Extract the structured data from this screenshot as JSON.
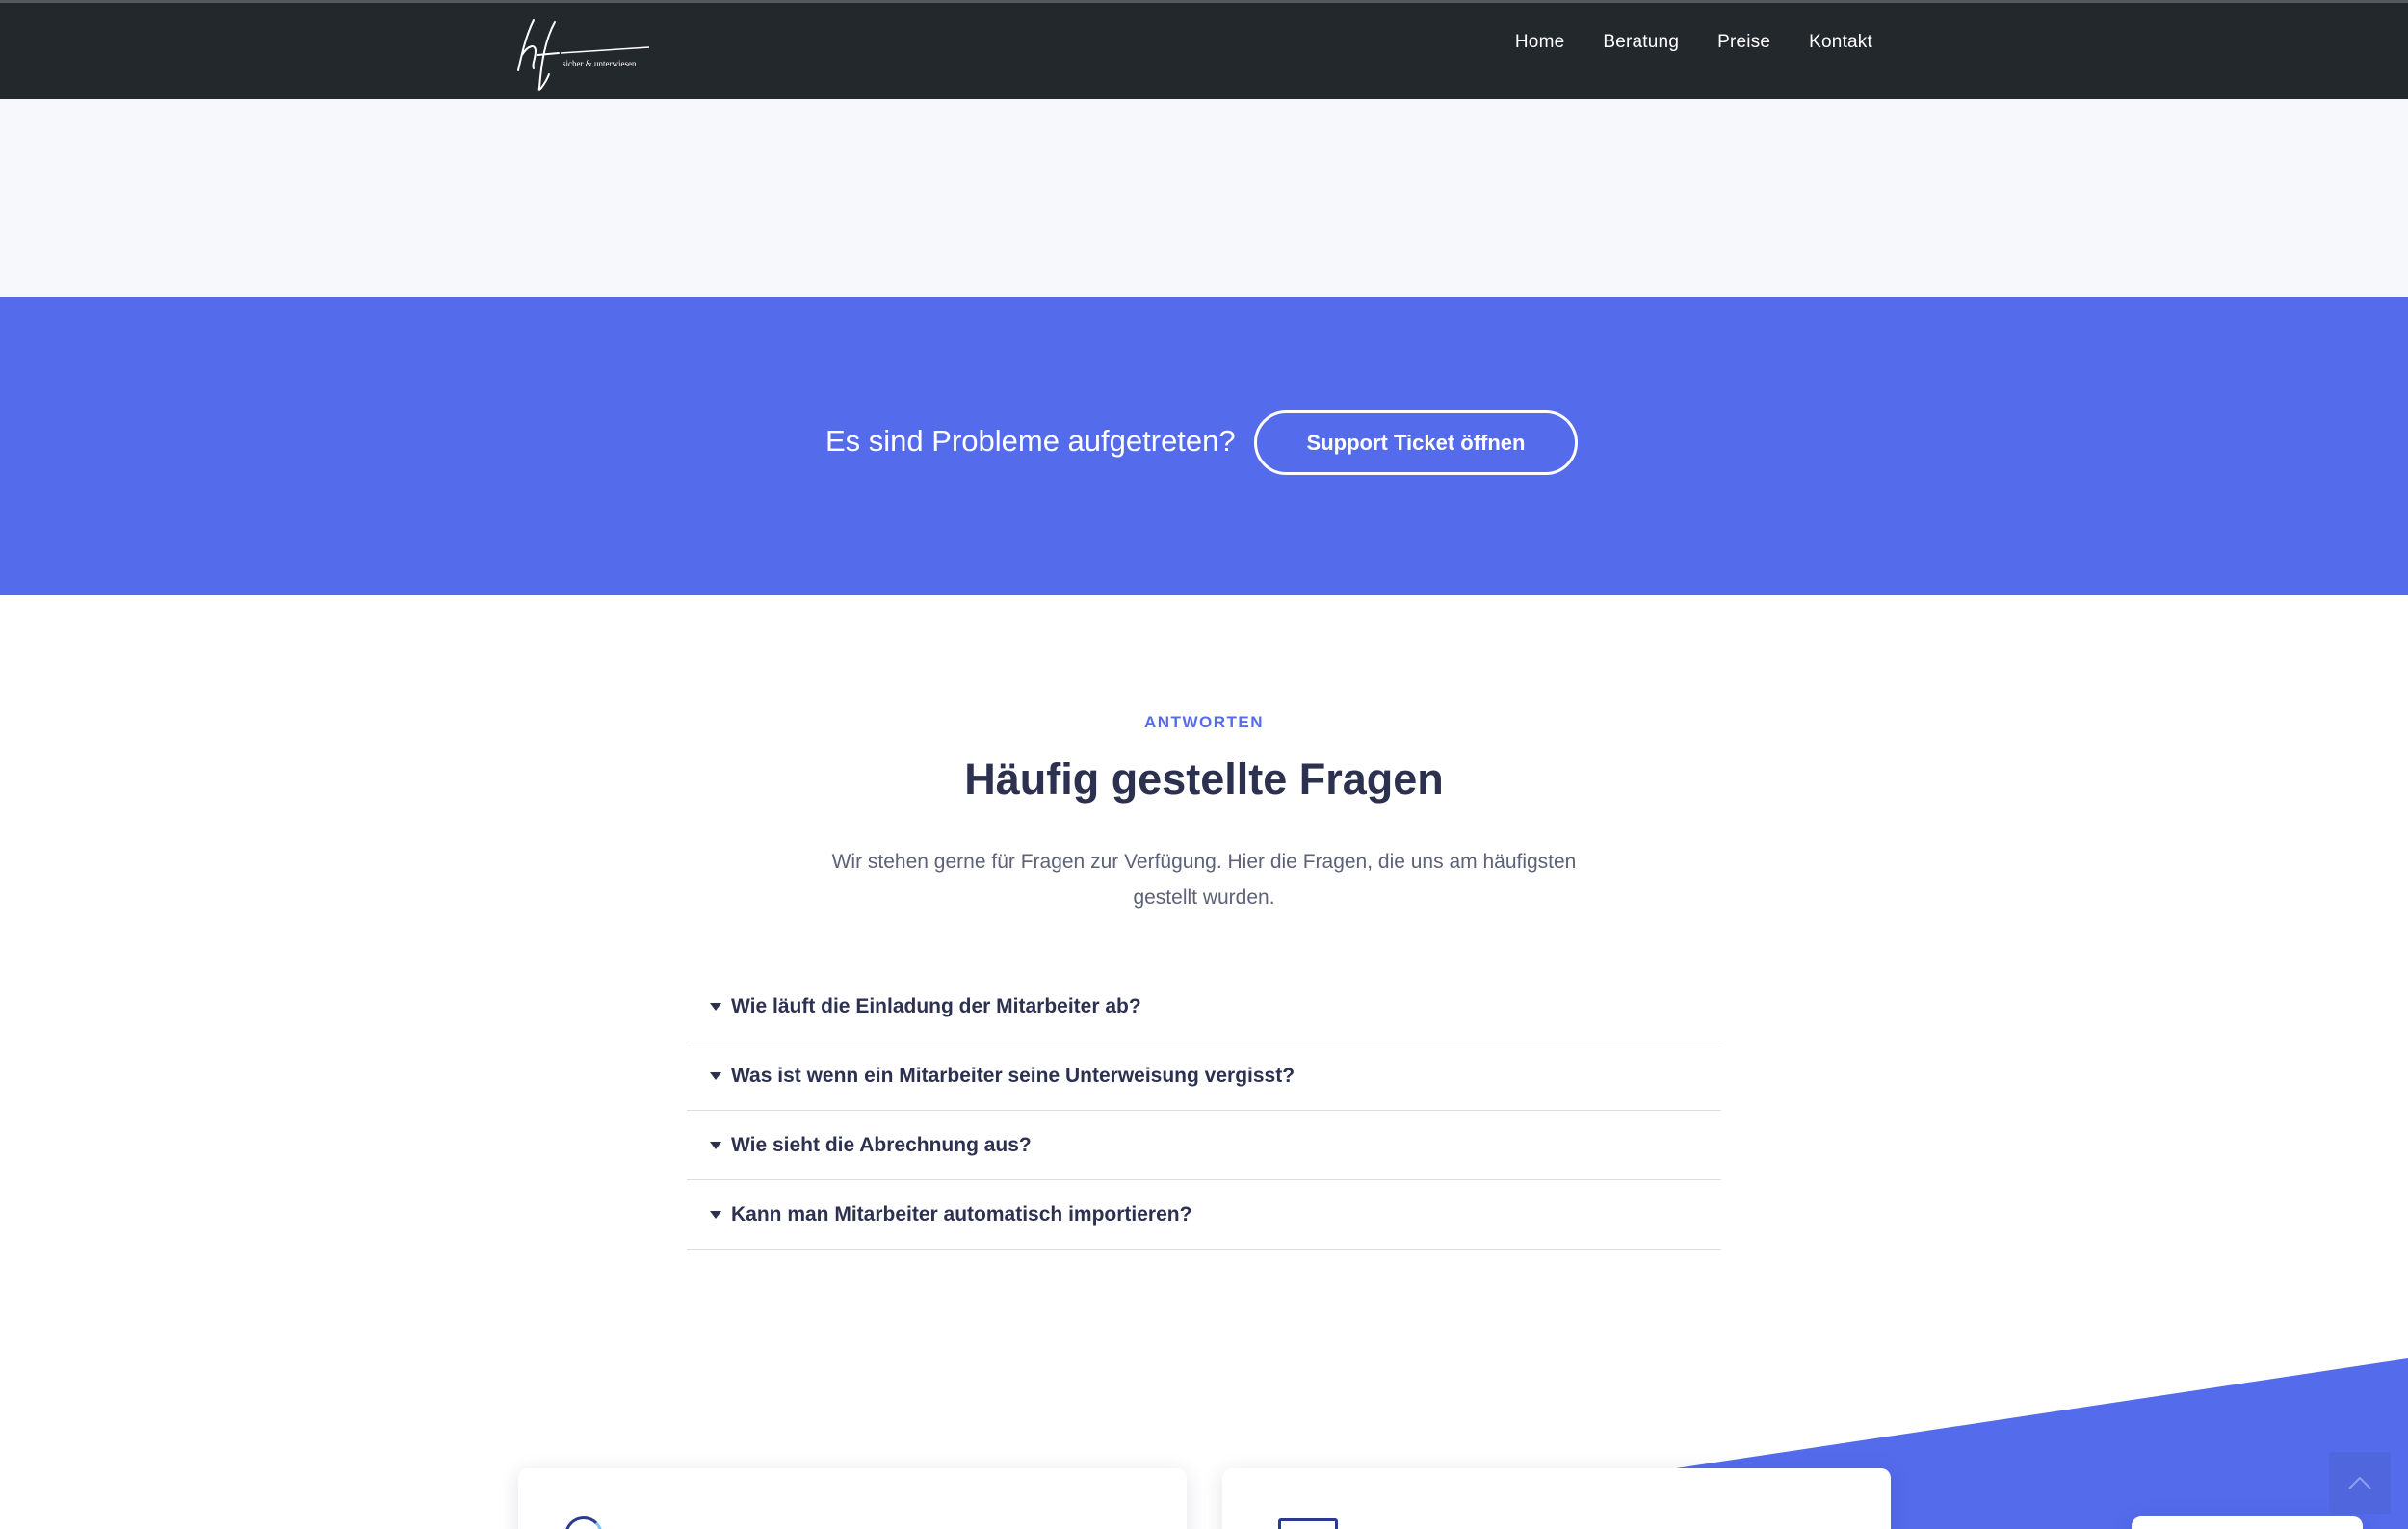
{
  "header": {
    "logo_tagline": "sicher & unterwiesen",
    "nav": [
      {
        "label": "Home"
      },
      {
        "label": "Beratung"
      },
      {
        "label": "Preise"
      },
      {
        "label": "Kontakt"
      }
    ]
  },
  "cta": {
    "text": "Es sind Probleme aufgetreten?",
    "button_label": "Support Ticket öffnen"
  },
  "faq": {
    "eyebrow": "ANTWORTEN",
    "title": "Häufig gestellte Fragen",
    "description": "Wir stehen gerne für Fragen zur Verfügung. Hier die Fragen, die uns am häufigsten gestellt wurden.",
    "items": [
      {
        "question": "Wie läuft die Einladung der Mitarbeiter ab?"
      },
      {
        "question": "Was ist wenn ein Mitarbeiter seine Unterweisung vergisst?"
      },
      {
        "question": "Wie sieht die Abrechnung aus?"
      },
      {
        "question": "Kann man Mitarbeiter automatisch importieren?"
      }
    ]
  },
  "colors": {
    "navbar": "#23282c",
    "accent": "#546bec",
    "heading": "#2d3150",
    "light_band": "#f7f8fc"
  },
  "icons": {
    "faq_toggle": "caret-down-icon",
    "scroll_top": "chevron-up-icon"
  }
}
